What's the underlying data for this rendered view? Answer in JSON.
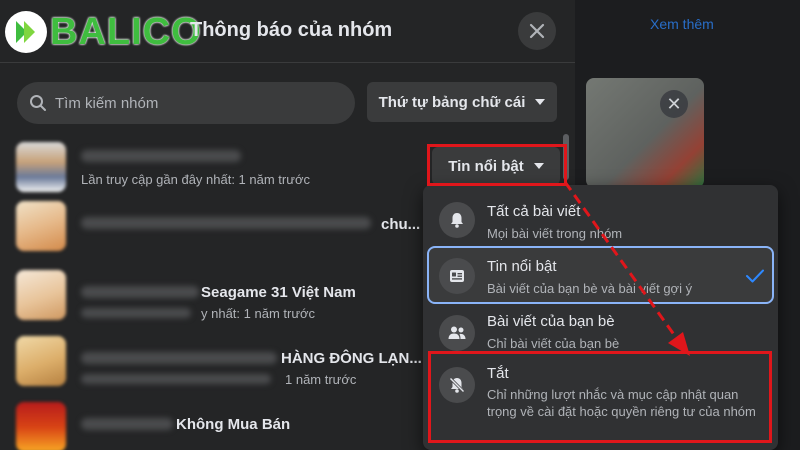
{
  "background": {
    "link_text": "Xem thêm"
  },
  "logo": {
    "text": "BALICO"
  },
  "panel": {
    "title": "Thông báo của nhóm"
  },
  "search": {
    "placeholder": "Tìm kiếm nhóm"
  },
  "sort": {
    "label": "Thứ tự bảng chữ cái"
  },
  "groups": [
    {
      "name": "",
      "subtitle": "Lần truy cập gần đây nhất: 1 năm trước",
      "setting": "Tin nổi bật"
    },
    {
      "name": "chu...",
      "subtitle": ""
    },
    {
      "name": "Seagame 31 Việt Nam",
      "subtitle": "y nhất: 1 năm trước"
    },
    {
      "name": "HÀNG ĐÔNG LẠN...",
      "subtitle": "1 năm trước"
    },
    {
      "name": "Không Mua Bán",
      "subtitle": ""
    }
  ],
  "menu": {
    "options": [
      {
        "title": "Tất cả bài viết",
        "desc": "Mọi bài viết trong nhóm",
        "icon": "bell-icon",
        "selected": false
      },
      {
        "title": "Tin nổi bật",
        "desc": "Bài viết của bạn bè và bài viết gợi ý",
        "icon": "news-feed-icon",
        "selected": true
      },
      {
        "title": "Bài viết của bạn bè",
        "desc": "Chỉ bài viết của bạn bè",
        "icon": "friends-icon",
        "selected": false
      },
      {
        "title": "Tắt",
        "desc": "Chỉ những lượt nhắc và mục cập nhật quan trọng về cài đặt hoặc quyền riêng tư của nhóm",
        "icon": "bell-off-icon",
        "selected": false
      }
    ]
  },
  "colors": {
    "annotation": "#e0161b",
    "selected_border": "#8ab4f8",
    "checkmark": "#2d88ff",
    "logo_green": "#3fbd3f"
  }
}
